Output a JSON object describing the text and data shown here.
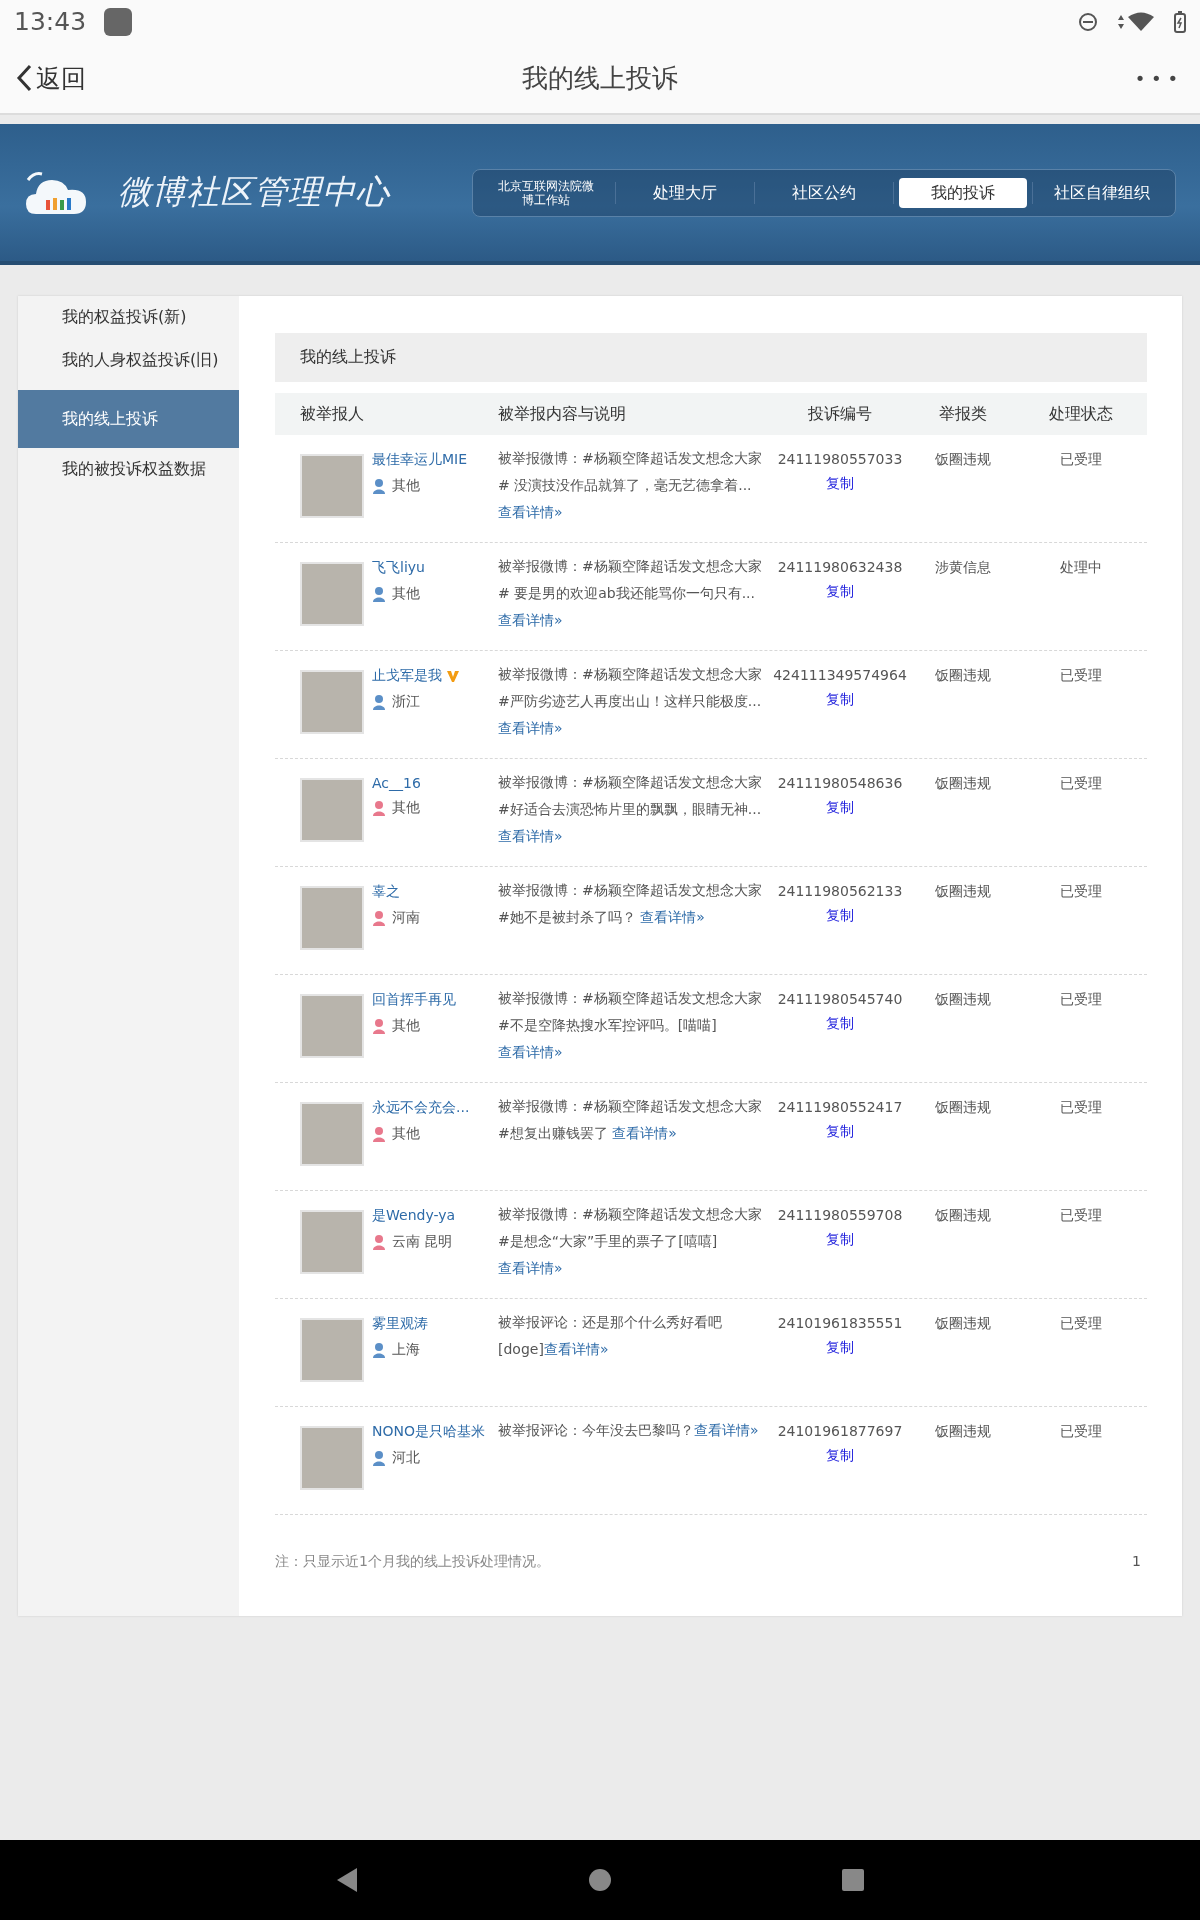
{
  "status_bar": {
    "time": "13:43"
  },
  "nav_bar": {
    "back": "返回",
    "title": "我的线上投诉",
    "more": "• • •"
  },
  "banner": {
    "site_title": "微博社区管理中心",
    "tabs": [
      {
        "label": "北京互联网法院微博工作站",
        "selected": false,
        "kind": "small"
      },
      {
        "label": "处理大厅",
        "selected": false,
        "kind": "normal"
      },
      {
        "label": "社区公约",
        "selected": false,
        "kind": "normal"
      },
      {
        "label": "我的投诉",
        "selected": true,
        "kind": "normal"
      },
      {
        "label": "社区自律组织",
        "selected": false,
        "kind": "normal"
      }
    ]
  },
  "sidebar": {
    "items": [
      {
        "label": "我的权益投诉(新)",
        "selected": false
      },
      {
        "label": "我的人身权益投诉(旧)",
        "selected": false
      },
      {
        "label": "我的线上投诉",
        "selected": true
      },
      {
        "label": "我的被投诉权益数据",
        "selected": false
      }
    ]
  },
  "panel": {
    "title": "我的线上投诉",
    "table": {
      "columns": [
        "被举报人",
        "被举报内容与说明",
        "投诉编号",
        "举报类",
        "处理状态"
      ],
      "rows": [
        {
          "name": "最佳幸运儿MIE",
          "verified": false,
          "location": "其他",
          "color": "#5b8fc7",
          "content": "被举报微博：#杨颖空降超话发文想念大家# 没演技没作品就算了，毫无艺德拿着...",
          "link": "查看详情»",
          "number": "24111980557033",
          "copy": "复制",
          "category": "饭圈违规",
          "status": "已受理"
        },
        {
          "name": "飞飞liyu",
          "verified": false,
          "location": "其他",
          "color": "#5b8fc7",
          "content": "被举报微博：#杨颖空降超话发文想念大家# 要是男的欢迎ab我还能骂你一句只有...",
          "link": "查看详情»",
          "number": "24111980632438",
          "copy": "复制",
          "category": "涉黄信息",
          "status": "处理中"
        },
        {
          "name": "止戈军是我",
          "verified": true,
          "location": "浙江",
          "color": "#5b8fc7",
          "content": "被举报微博：#杨颖空降超话发文想念大家#严防劣迹艺人再度出山！这样只能极度...",
          "link": "查看详情»",
          "number": "424111349574964",
          "copy": "复制",
          "category": "饭圈违规",
          "status": "已受理"
        },
        {
          "name": "Ac__16",
          "verified": false,
          "location": "其他",
          "color": "#e8788c",
          "content": "被举报微博：#杨颖空降超话发文想念大家#好适合去演恐怖片里的飘飘，眼睛无神...",
          "link": "查看详情»",
          "number": "24111980548636",
          "copy": "复制",
          "category": "饭圈违规",
          "status": "已受理"
        },
        {
          "name": "辜之",
          "verified": false,
          "location": "河南",
          "color": "#e8788c",
          "content": "被举报微博：#杨颖空降超话发文想念大家#她不是被封杀了吗？ ",
          "link": "查看详情»",
          "number": "24111980562133",
          "copy": "复制",
          "category": "饭圈违规",
          "status": "已受理"
        },
        {
          "name": "回首挥手再见",
          "verified": false,
          "location": "其他",
          "color": "#e8788c",
          "content": "被举报微博：#杨颖空降超话发文想念大家#不是空降热搜水军控评吗。[喵喵] ",
          "link": "查看详情»",
          "number": "24111980545740",
          "copy": "复制",
          "category": "饭圈违规",
          "status": "已受理"
        },
        {
          "name": "永远不会充会...",
          "verified": false,
          "location": "其他",
          "color": "#e8788c",
          "content": "被举报微博：#杨颖空降超话发文想念大家#想复出赚钱罢了 ",
          "link": "查看详情»",
          "number": "24111980552417",
          "copy": "复制",
          "category": "饭圈违规",
          "status": "已受理"
        },
        {
          "name": "是Wendy-ya",
          "verified": false,
          "location": "云南 昆明",
          "color": "#e8788c",
          "content": "被举报微博：#杨颖空降超话发文想念大家#是想念“大家”手里的票子了[嘻嘻] ",
          "link": "查看详情»",
          "number": "24111980559708",
          "copy": "复制",
          "category": "饭圈违规",
          "status": "已受理"
        },
        {
          "name": "雾里观涛",
          "verified": false,
          "location": "上海",
          "color": "#5b8fc7",
          "content": "被举报评论：还是那个什么秀好看吧[doge]",
          "link": "查看详情»",
          "number": "24101961835551",
          "copy": "复制",
          "category": "饭圈违规",
          "status": "已受理"
        },
        {
          "name": "NONO是只哈基米",
          "verified": false,
          "location": "河北",
          "color": "#5b8fc7",
          "content": "被举报评论：今年没去巴黎吗？",
          "link": "查看详情»",
          "number": "24101961877697",
          "copy": "复制",
          "category": "饭圈违规",
          "status": "已受理"
        }
      ]
    },
    "note": "注：只显示近1个月我的线上投诉处理情况。",
    "page": "1"
  }
}
